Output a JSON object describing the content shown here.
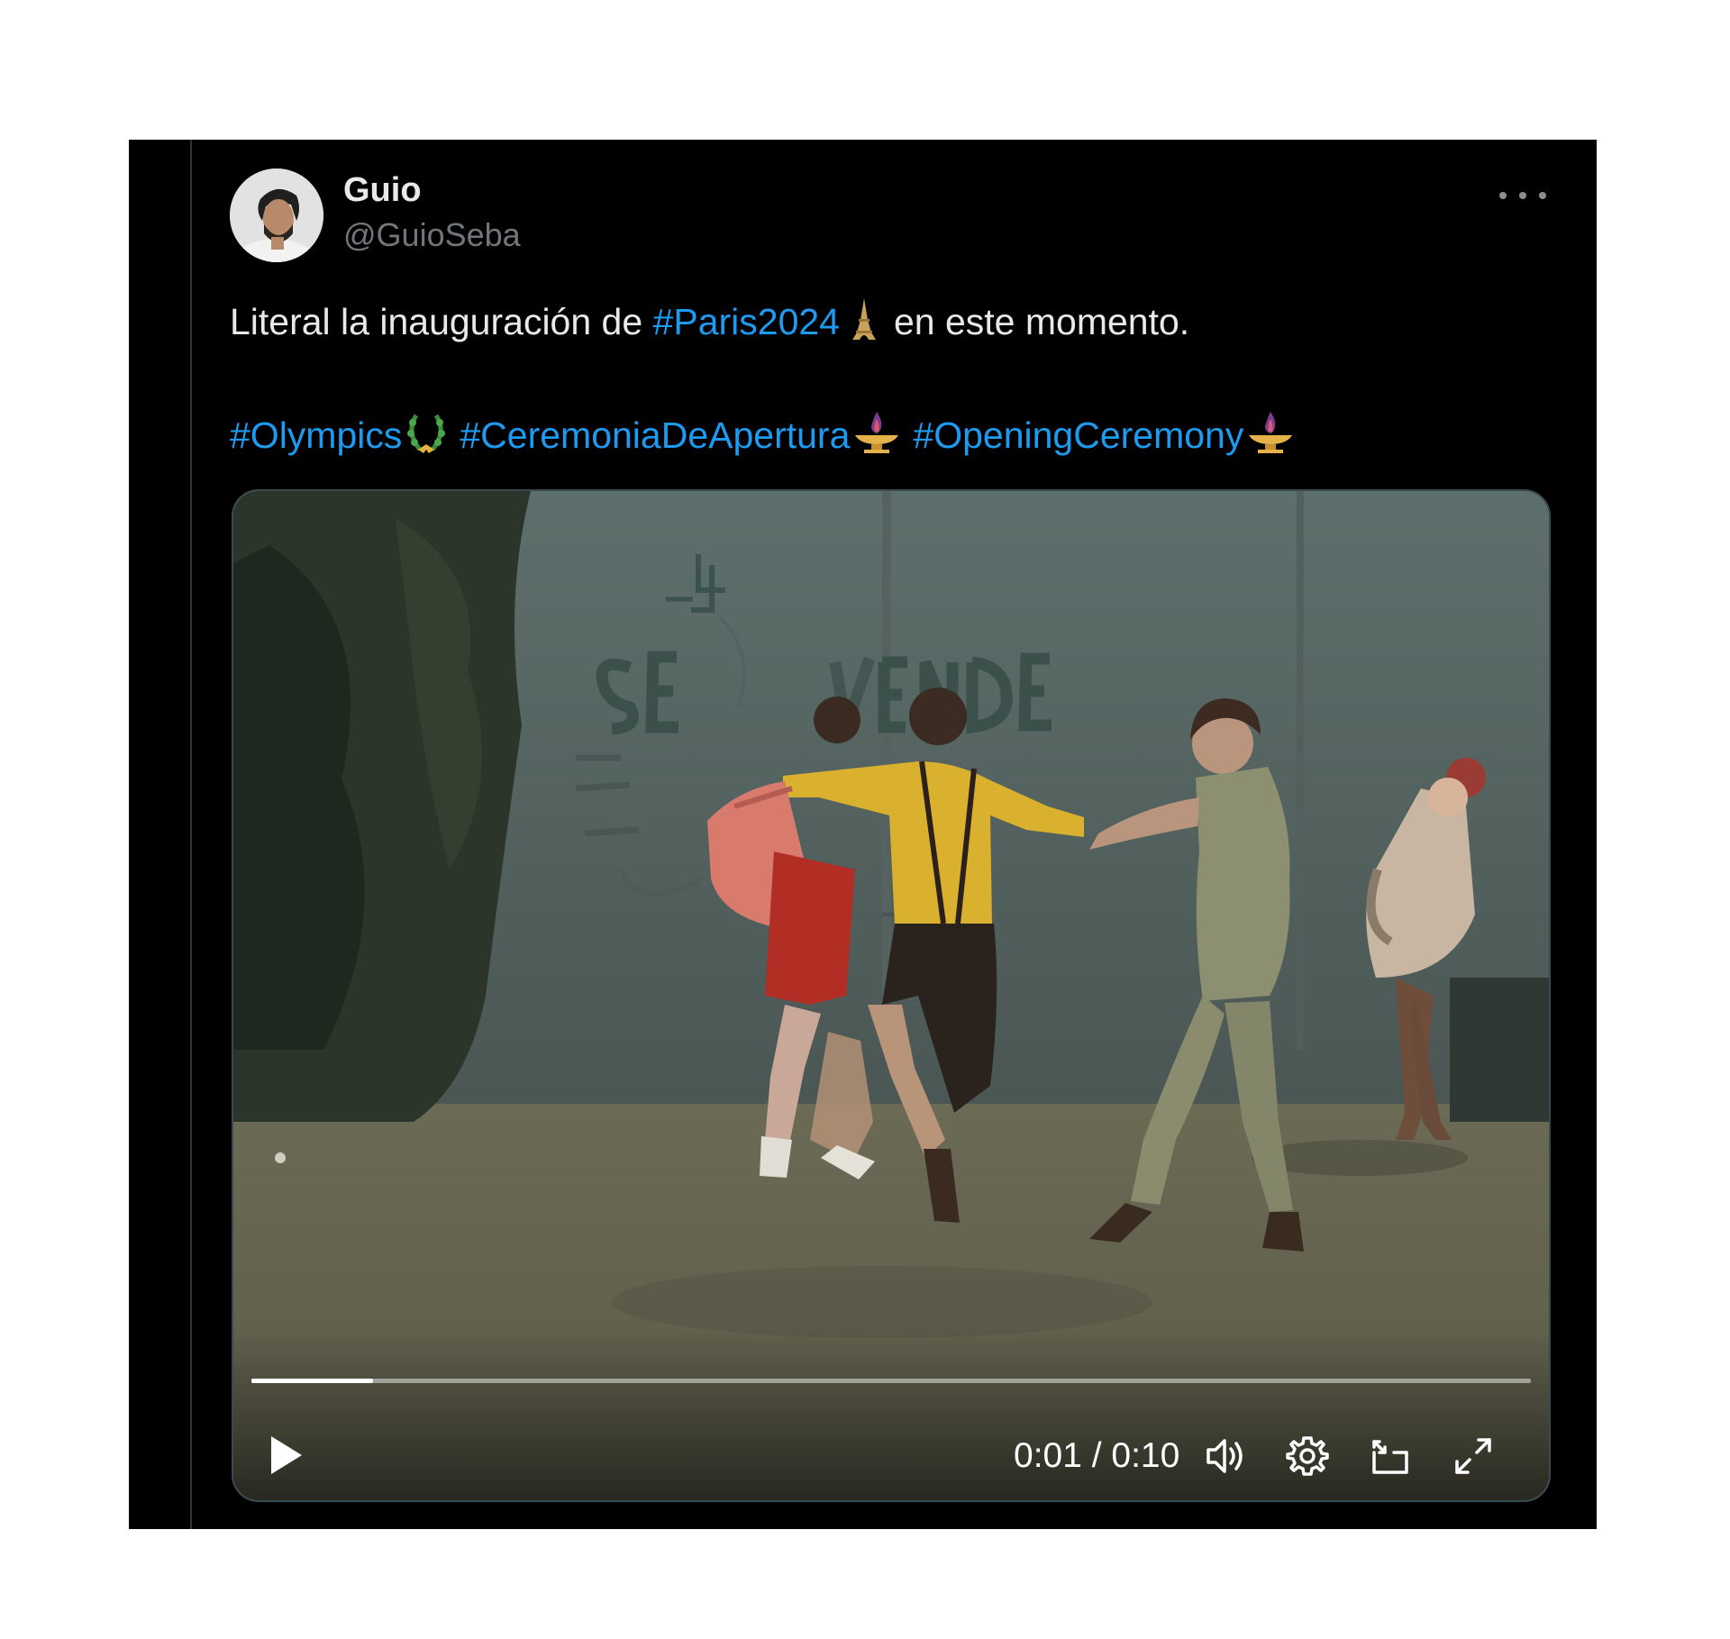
{
  "tweet": {
    "author_name": "Guio",
    "author_handle": "@GuioSeba",
    "line1": {
      "before": "Literal la inauguración de ",
      "hashtag": "#Paris2024",
      "emoji": "eiffel-tower-icon",
      "after": "en este momento."
    },
    "line2": {
      "hashtags": [
        "#Olympics",
        "#CeremoniaDeApertura",
        "#OpeningCeremony"
      ],
      "emojis": [
        "laurel-wreath-icon",
        "torch-icon",
        "torch-icon"
      ]
    }
  },
  "video": {
    "time_display": "0:01 / 0:10",
    "progress": 0.095,
    "controls": [
      "play-icon",
      "volume-icon",
      "settings-icon",
      "pip-icon",
      "fullscreen-icon"
    ]
  },
  "colors": {
    "background": "#000000",
    "text": "#e7e9ea",
    "secondary_text": "#71767b",
    "hashtag": "#1d9bf0"
  }
}
